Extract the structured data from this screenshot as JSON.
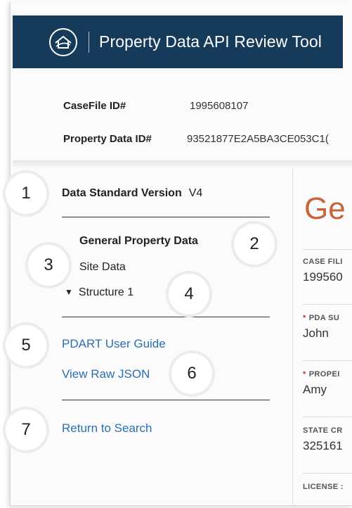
{
  "app": {
    "title": "Property Data API Review Tool"
  },
  "meta": {
    "case_file_label": "CaseFile ID#",
    "case_file_value": "1995608107",
    "property_data_label": "Property Data ID#",
    "property_data_value": "93521877E2A5BA3CE053C1("
  },
  "nav": {
    "version_label": "Data Standard Version",
    "version_value": "V4",
    "items": [
      {
        "label": "General Property Data",
        "active": true
      },
      {
        "label": "Site Data",
        "active": false
      },
      {
        "label": "Structure 1",
        "active": false
      }
    ],
    "links": {
      "user_guide": "PDART User Guide",
      "view_json": "View Raw JSON",
      "return_search": "Return to Search"
    }
  },
  "callouts": [
    "1",
    "2",
    "3",
    "4",
    "5",
    "6",
    "7"
  ],
  "panel": {
    "title": "Ge",
    "fields": [
      {
        "label": "CASE FILI",
        "value": "199560",
        "required": false
      },
      {
        "label": "PDA SU",
        "value": "John",
        "required": true
      },
      {
        "label": "PROPEI",
        "value": "Amy",
        "required": true
      },
      {
        "label": "STATE CR",
        "value": "325161",
        "required": false
      },
      {
        "label": "LICENSE :",
        "value": "",
        "required": false
      }
    ]
  },
  "colors": {
    "header_bg": "#163b5a",
    "link": "#2a6fb4",
    "title_accent": "#c8643c",
    "required": "#c62d2d"
  }
}
